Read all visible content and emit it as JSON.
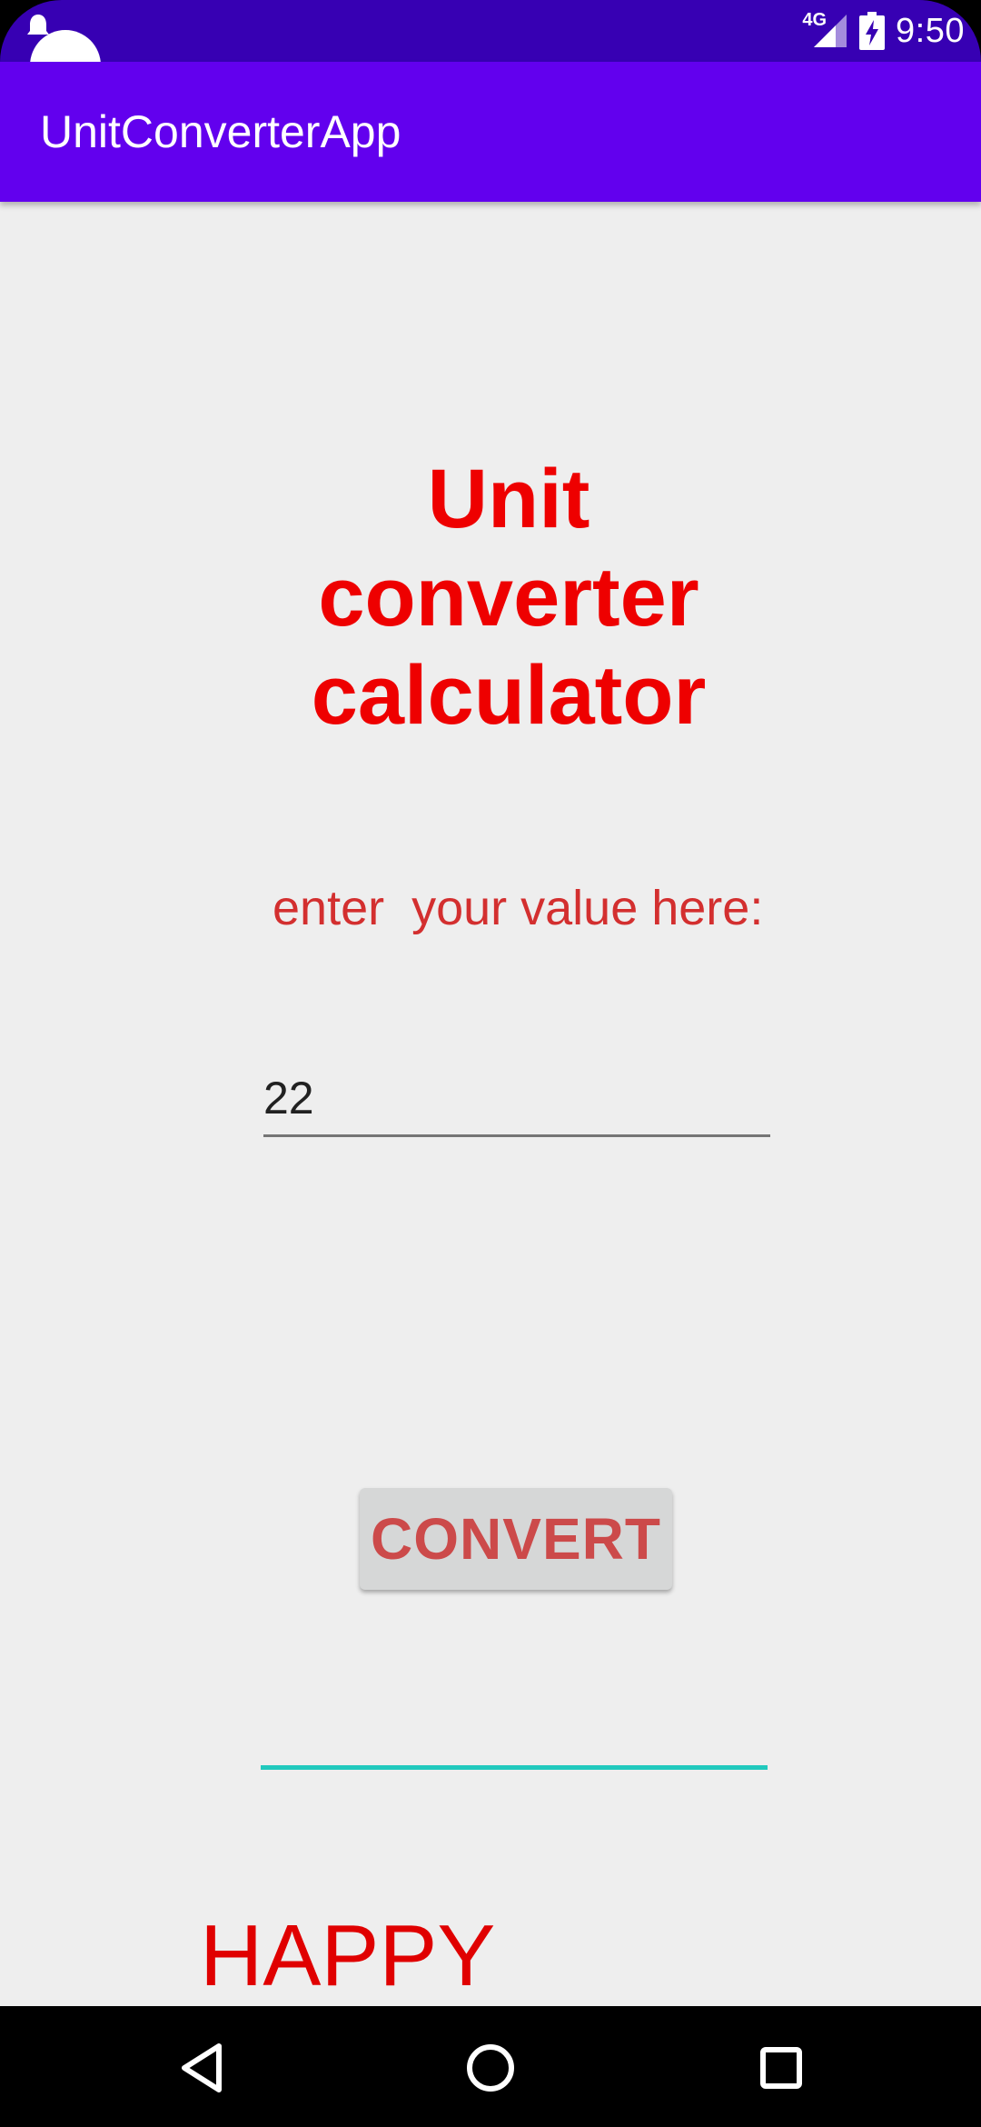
{
  "status_bar": {
    "network": "4G",
    "time": "9:50",
    "icons": [
      "notification-icon",
      "signal-icon",
      "battery-charging-icon"
    ],
    "color": "#3700b3"
  },
  "app_bar": {
    "title": "UnitConverterApp",
    "color": "#6200ee"
  },
  "main": {
    "heading": "Unit converter calculator",
    "prompt": "enter  your value here:",
    "input_value": "22",
    "convert_label": "CONVERT",
    "result_value": "",
    "footer": "HAPPY CONVERSION!!!",
    "accent_red": "#ee0000",
    "underline_teal": "#20c9bd"
  },
  "nav_bar": {
    "icons": [
      "back-icon",
      "home-icon",
      "recents-icon"
    ]
  }
}
